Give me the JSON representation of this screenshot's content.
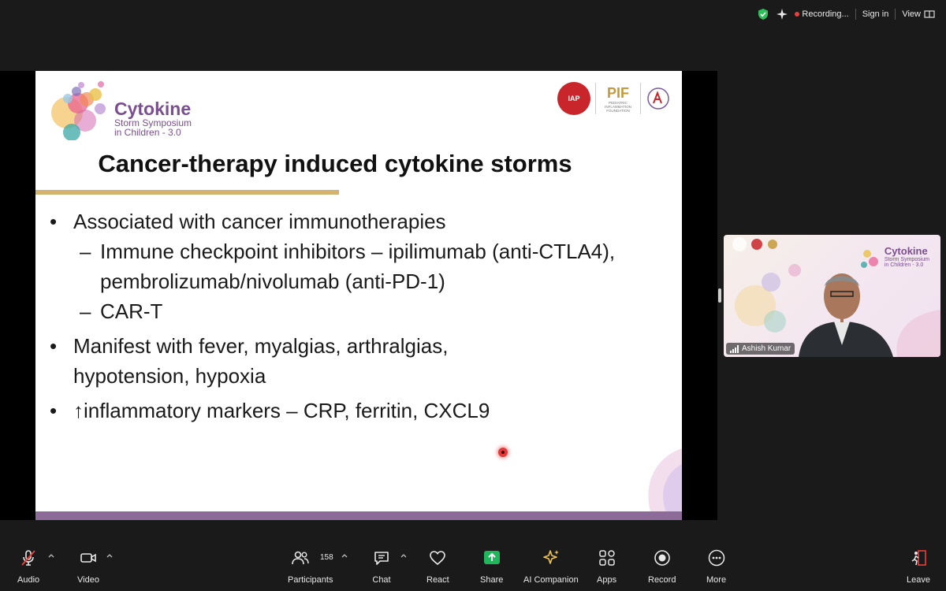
{
  "topbar": {
    "recording_label": "Recording...",
    "sign_in_label": "Sign in",
    "view_label": "View"
  },
  "slide": {
    "brand_title": "Cytokine",
    "brand_subtitle_1": "Storm Symposium",
    "brand_subtitle_2": "in Children - 3.0",
    "logo_iap": "IAP",
    "logo_pif": "PIF",
    "logo_pif_text": "PEDIATRIC INFLAMMATION FOUNDATION",
    "title": "Cancer-therapy induced cytokine storms",
    "bullets": [
      {
        "bullet": "•",
        "text": "Associated with cancer immunotherapies",
        "subs": [
          {
            "dash": "–",
            "text": "Immune checkpoint inhibitors – ipilimumab (anti-CTLA4), pembrolizumab/nivolumab (anti-PD-1)"
          },
          {
            "dash": "–",
            "text": "CAR-T"
          }
        ]
      },
      {
        "bullet": "•",
        "text": "Manifest with fever, myalgias, arthralgias, hypotension, hypoxia"
      },
      {
        "bullet": "•",
        "text": "↑inflammatory markers – CRP, ferritin, CXCL9"
      }
    ]
  },
  "video": {
    "participant_name": "Ashish Kumar",
    "brand_title": "Cytokine",
    "brand_subtitle_1": "Storm Symposium",
    "brand_subtitle_2": "in Children - 3.0"
  },
  "toolbar": {
    "audio": "Audio",
    "video": "Video",
    "participants": "Participants",
    "participant_count": "158",
    "chat": "Chat",
    "react": "React",
    "share": "Share",
    "ai_companion": "AI Companion",
    "apps": "Apps",
    "record": "Record",
    "more": "More",
    "leave": "Leave"
  },
  "colors": {
    "brand_purple": "#7a4f8f",
    "title_rule_gold": "#d4b270",
    "share_green": "#1fb65c",
    "leave_red": "#e8403c",
    "ai_gold": "#f0c35a"
  }
}
